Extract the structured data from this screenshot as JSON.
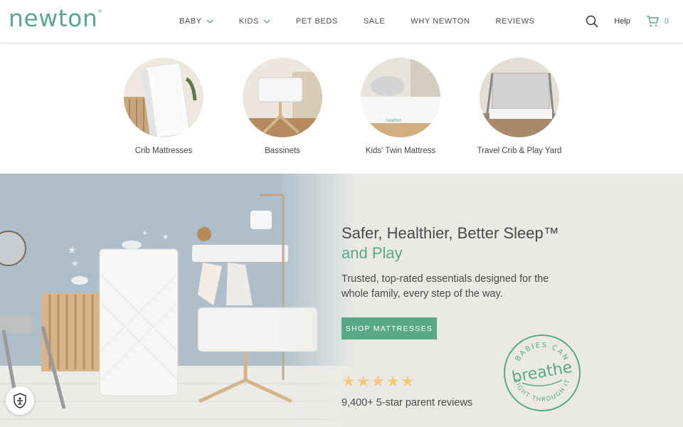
{
  "brand": {
    "logo_text": "newton",
    "accent_color": "#5aa88a"
  },
  "nav": {
    "items": [
      {
        "label": "BABY",
        "has_dropdown": true
      },
      {
        "label": "KIDS",
        "has_dropdown": true
      },
      {
        "label": "PET BEDS",
        "has_dropdown": false
      },
      {
        "label": "SALE",
        "has_dropdown": false
      },
      {
        "label": "WHY NEWTON",
        "has_dropdown": false
      },
      {
        "label": "REVIEWS",
        "has_dropdown": false
      }
    ],
    "help_label": "Help",
    "cart_count": "0",
    "icons": {
      "search": "search-icon",
      "cart": "cart-icon",
      "dropdown": "chevron-down-icon"
    }
  },
  "categories": [
    {
      "label": "Crib Mattresses"
    },
    {
      "label": "Bassinets"
    },
    {
      "label": "Kids' Twin Mattress"
    },
    {
      "label": "Travel Crib & Play Yard"
    }
  ],
  "hero": {
    "headline_line1": "Safer, Healthier, Better Sleep™",
    "headline_line2": "and Play",
    "subtext": "Trusted, top-rated essentials designed for the whole family, every step of the way.",
    "cta_label": "SHOP MATTRESSES",
    "rating_stars": 5,
    "reviews_text": "9,400+ 5-star parent reviews",
    "badge": {
      "top": "BABIES CAN",
      "middle": "breathe",
      "bottom": "RIGHT THROUGH IT"
    }
  },
  "accessibility": {
    "icon": "accessibility-icon"
  }
}
